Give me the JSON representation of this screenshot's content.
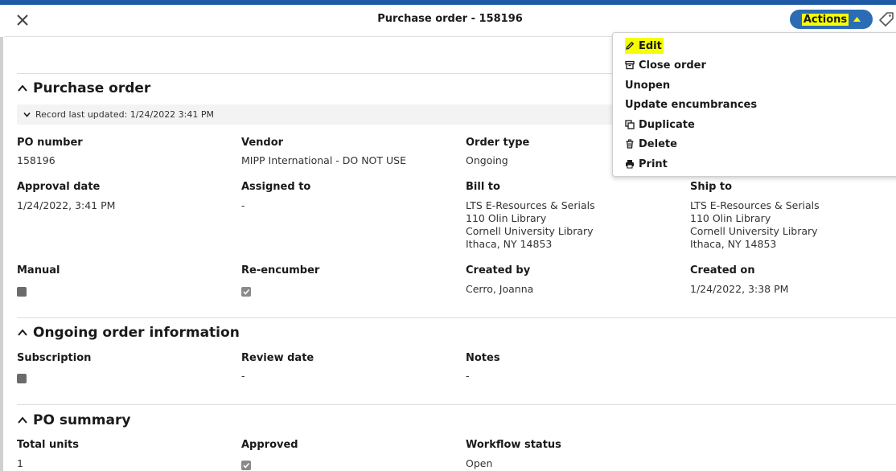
{
  "header": {
    "title": "Purchase order - 158196",
    "actions_label": "Actions"
  },
  "menu": {
    "items": [
      {
        "label": "Edit",
        "icon": "pencil-icon"
      },
      {
        "label": "Close order",
        "icon": "archive-icon"
      },
      {
        "label": "Unopen",
        "icon": ""
      },
      {
        "label": "Update encumbrances",
        "icon": ""
      },
      {
        "label": "Duplicate",
        "icon": "copy-icon"
      },
      {
        "label": "Delete",
        "icon": "trash-icon"
      },
      {
        "label": "Print",
        "icon": "printer-icon"
      }
    ]
  },
  "purchase_order": {
    "title": "Purchase order",
    "record_updated": "Record last updated: 1/24/2022 3:41 PM",
    "fields": {
      "po_number": {
        "label": "PO number",
        "value": "158196"
      },
      "vendor": {
        "label": "Vendor",
        "value": "MIPP International - DO NOT USE"
      },
      "order_type": {
        "label": "Order type",
        "value": "Ongoing"
      },
      "approval_date": {
        "label": "Approval date",
        "value": "1/24/2022, 3:41 PM"
      },
      "assigned_to": {
        "label": "Assigned to",
        "value": "-"
      },
      "bill_to": {
        "label": "Bill to",
        "lines": [
          "LTS E-Resources & Serials",
          "110 Olin Library",
          "Cornell University Library",
          "Ithaca, NY 14853"
        ]
      },
      "ship_to": {
        "label": "Ship to",
        "lines": [
          "LTS E-Resources & Serials",
          "110 Olin Library",
          "Cornell University Library",
          "Ithaca, NY 14853"
        ]
      },
      "manual": {
        "label": "Manual",
        "checked": false
      },
      "reencumber": {
        "label": "Re-encumber",
        "checked": true
      },
      "created_by": {
        "label": "Created by",
        "value": "Cerro, Joanna"
      },
      "created_on": {
        "label": "Created on",
        "value": "1/24/2022, 3:38 PM"
      }
    }
  },
  "ongoing": {
    "title": "Ongoing order information",
    "subscription": {
      "label": "Subscription",
      "checked": false
    },
    "review_date": {
      "label": "Review date",
      "value": "-"
    },
    "notes": {
      "label": "Notes",
      "value": "-"
    }
  },
  "po_summary": {
    "title": "PO summary",
    "total_units": {
      "label": "Total units",
      "value": "1"
    },
    "approved": {
      "label": "Approved",
      "checked": true
    },
    "workflow_status": {
      "label": "Workflow status",
      "value": "Open"
    }
  },
  "colors": {
    "accent": "#2b6cb4",
    "highlight": "#f5ff00",
    "topbar": "#1f5aa6"
  }
}
